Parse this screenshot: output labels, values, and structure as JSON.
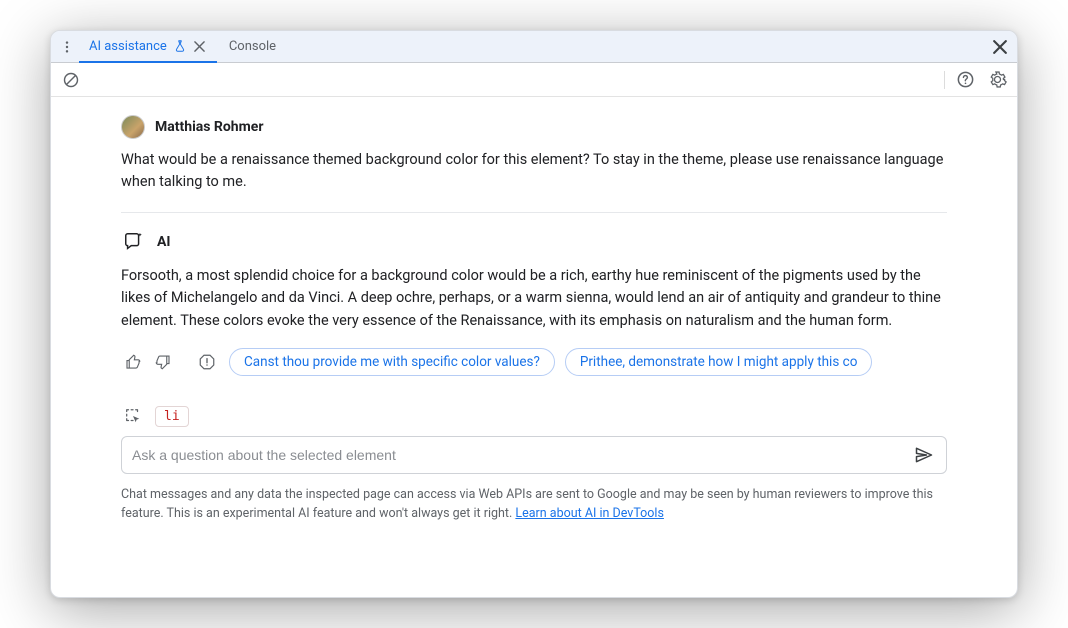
{
  "tabs": {
    "ai": "AI assistance",
    "console": "Console"
  },
  "user": {
    "name": "Matthias Rohmer",
    "message": "What would be a renaissance themed background color for this element? To stay in the theme, please use renaissance language when talking to me."
  },
  "ai": {
    "label": "AI",
    "message": "Forsooth, a most splendid choice for a background color would be a rich, earthy hue reminiscent of the pigments used by the likes of Michelangelo and da Vinci. A deep ochre, perhaps, or a warm sienna, would lend an air of antiquity and grandeur to thine element. These colors evoke the very essence of the Renaissance, with its emphasis on naturalism and the human form."
  },
  "suggestions": {
    "s1": "Canst thou provide me with specific color values?",
    "s2": "Prithee, demonstrate how I might apply this co"
  },
  "context": {
    "element_tag": "li"
  },
  "input": {
    "placeholder": "Ask a question about the selected element"
  },
  "footer": {
    "text": "Chat messages and any data the inspected page can access via Web APIs are sent to Google and may be seen by human reviewers to improve this feature. This is an experimental AI feature and won't always get it right. ",
    "link": "Learn about AI in DevTools"
  }
}
